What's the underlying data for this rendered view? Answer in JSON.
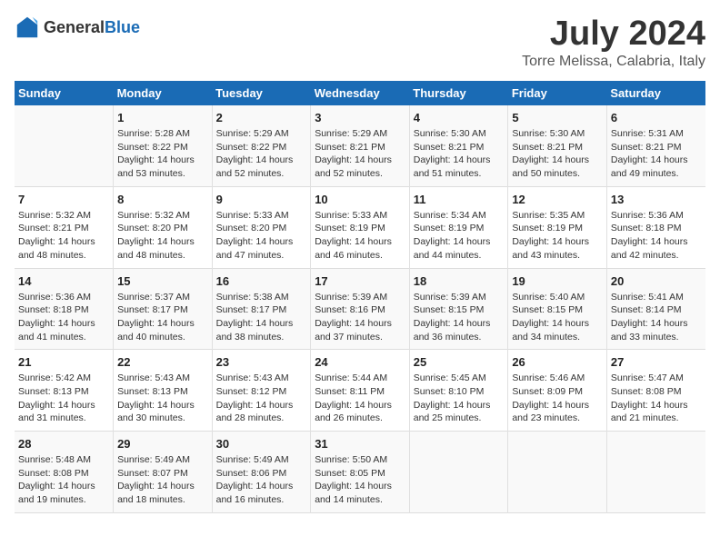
{
  "logo": {
    "text_general": "General",
    "text_blue": "Blue"
  },
  "header": {
    "main_title": "July 2024",
    "subtitle": "Torre Melissa, Calabria, Italy"
  },
  "weekdays": [
    "Sunday",
    "Monday",
    "Tuesday",
    "Wednesday",
    "Thursday",
    "Friday",
    "Saturday"
  ],
  "weeks": [
    [
      {
        "day": "",
        "info": ""
      },
      {
        "day": "1",
        "info": "Sunrise: 5:28 AM\nSunset: 8:22 PM\nDaylight: 14 hours\nand 53 minutes."
      },
      {
        "day": "2",
        "info": "Sunrise: 5:29 AM\nSunset: 8:22 PM\nDaylight: 14 hours\nand 52 minutes."
      },
      {
        "day": "3",
        "info": "Sunrise: 5:29 AM\nSunset: 8:21 PM\nDaylight: 14 hours\nand 52 minutes."
      },
      {
        "day": "4",
        "info": "Sunrise: 5:30 AM\nSunset: 8:21 PM\nDaylight: 14 hours\nand 51 minutes."
      },
      {
        "day": "5",
        "info": "Sunrise: 5:30 AM\nSunset: 8:21 PM\nDaylight: 14 hours\nand 50 minutes."
      },
      {
        "day": "6",
        "info": "Sunrise: 5:31 AM\nSunset: 8:21 PM\nDaylight: 14 hours\nand 49 minutes."
      }
    ],
    [
      {
        "day": "7",
        "info": "Sunrise: 5:32 AM\nSunset: 8:21 PM\nDaylight: 14 hours\nand 48 minutes."
      },
      {
        "day": "8",
        "info": "Sunrise: 5:32 AM\nSunset: 8:20 PM\nDaylight: 14 hours\nand 48 minutes."
      },
      {
        "day": "9",
        "info": "Sunrise: 5:33 AM\nSunset: 8:20 PM\nDaylight: 14 hours\nand 47 minutes."
      },
      {
        "day": "10",
        "info": "Sunrise: 5:33 AM\nSunset: 8:19 PM\nDaylight: 14 hours\nand 46 minutes."
      },
      {
        "day": "11",
        "info": "Sunrise: 5:34 AM\nSunset: 8:19 PM\nDaylight: 14 hours\nand 44 minutes."
      },
      {
        "day": "12",
        "info": "Sunrise: 5:35 AM\nSunset: 8:19 PM\nDaylight: 14 hours\nand 43 minutes."
      },
      {
        "day": "13",
        "info": "Sunrise: 5:36 AM\nSunset: 8:18 PM\nDaylight: 14 hours\nand 42 minutes."
      }
    ],
    [
      {
        "day": "14",
        "info": "Sunrise: 5:36 AM\nSunset: 8:18 PM\nDaylight: 14 hours\nand 41 minutes."
      },
      {
        "day": "15",
        "info": "Sunrise: 5:37 AM\nSunset: 8:17 PM\nDaylight: 14 hours\nand 40 minutes."
      },
      {
        "day": "16",
        "info": "Sunrise: 5:38 AM\nSunset: 8:17 PM\nDaylight: 14 hours\nand 38 minutes."
      },
      {
        "day": "17",
        "info": "Sunrise: 5:39 AM\nSunset: 8:16 PM\nDaylight: 14 hours\nand 37 minutes."
      },
      {
        "day": "18",
        "info": "Sunrise: 5:39 AM\nSunset: 8:15 PM\nDaylight: 14 hours\nand 36 minutes."
      },
      {
        "day": "19",
        "info": "Sunrise: 5:40 AM\nSunset: 8:15 PM\nDaylight: 14 hours\nand 34 minutes."
      },
      {
        "day": "20",
        "info": "Sunrise: 5:41 AM\nSunset: 8:14 PM\nDaylight: 14 hours\nand 33 minutes."
      }
    ],
    [
      {
        "day": "21",
        "info": "Sunrise: 5:42 AM\nSunset: 8:13 PM\nDaylight: 14 hours\nand 31 minutes."
      },
      {
        "day": "22",
        "info": "Sunrise: 5:43 AM\nSunset: 8:13 PM\nDaylight: 14 hours\nand 30 minutes."
      },
      {
        "day": "23",
        "info": "Sunrise: 5:43 AM\nSunset: 8:12 PM\nDaylight: 14 hours\nand 28 minutes."
      },
      {
        "day": "24",
        "info": "Sunrise: 5:44 AM\nSunset: 8:11 PM\nDaylight: 14 hours\nand 26 minutes."
      },
      {
        "day": "25",
        "info": "Sunrise: 5:45 AM\nSunset: 8:10 PM\nDaylight: 14 hours\nand 25 minutes."
      },
      {
        "day": "26",
        "info": "Sunrise: 5:46 AM\nSunset: 8:09 PM\nDaylight: 14 hours\nand 23 minutes."
      },
      {
        "day": "27",
        "info": "Sunrise: 5:47 AM\nSunset: 8:08 PM\nDaylight: 14 hours\nand 21 minutes."
      }
    ],
    [
      {
        "day": "28",
        "info": "Sunrise: 5:48 AM\nSunset: 8:08 PM\nDaylight: 14 hours\nand 19 minutes."
      },
      {
        "day": "29",
        "info": "Sunrise: 5:49 AM\nSunset: 8:07 PM\nDaylight: 14 hours\nand 18 minutes."
      },
      {
        "day": "30",
        "info": "Sunrise: 5:49 AM\nSunset: 8:06 PM\nDaylight: 14 hours\nand 16 minutes."
      },
      {
        "day": "31",
        "info": "Sunrise: 5:50 AM\nSunset: 8:05 PM\nDaylight: 14 hours\nand 14 minutes."
      },
      {
        "day": "",
        "info": ""
      },
      {
        "day": "",
        "info": ""
      },
      {
        "day": "",
        "info": ""
      }
    ]
  ]
}
